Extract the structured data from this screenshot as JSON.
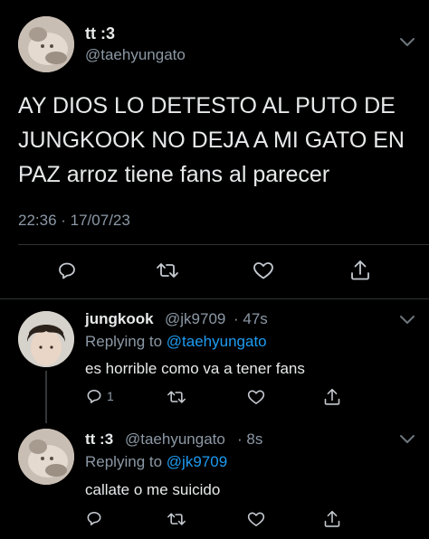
{
  "main_tweet": {
    "display_name": "tt :3",
    "username": "@taehyungato",
    "text_lines": [
      "AY DIOS LO DETESTO AL PUTO DE",
      "JUNGKOOK NO DEJA A MI GATO EN",
      "PAZ arroz tiene fans al parecer"
    ],
    "timestamp": "22:36 · 17/07/23"
  },
  "replies": [
    {
      "display_name": "jungkook",
      "username": "@jk9709",
      "time": "· 47s",
      "replying_prefix": "Replying to",
      "replying_to": "@taehyungato",
      "text": "es horrible como va a tener fans",
      "reply_count": "1"
    },
    {
      "display_name": "tt :3",
      "username": "@taehyungato",
      "time": "· 8s",
      "replying_prefix": "Replying to",
      "replying_to": "@jk9709",
      "text": "callate o me suicido",
      "reply_count": ""
    }
  ],
  "icons": [
    "chevron-down-icon",
    "reply-icon",
    "retweet-icon",
    "like-icon",
    "share-icon"
  ],
  "colors": {
    "background": "#000000",
    "text": "#e7e9ea",
    "muted": "#8b98a5",
    "link": "#1d9bf0",
    "divider": "#2f3336"
  }
}
